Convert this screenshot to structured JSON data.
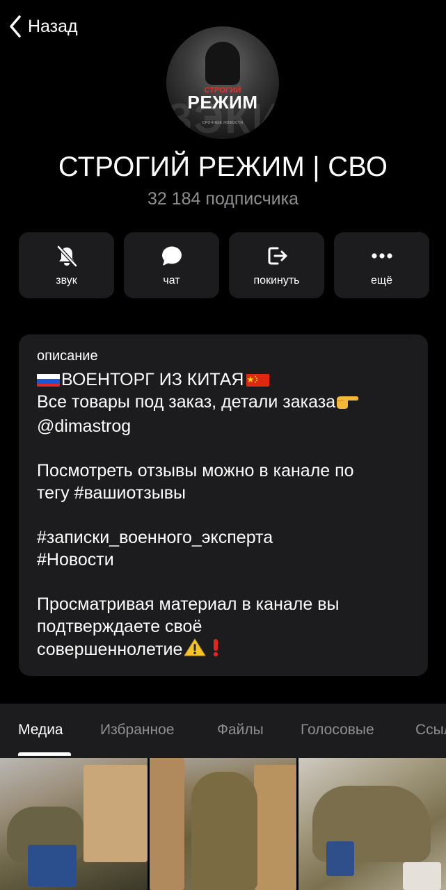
{
  "nav": {
    "back_label": "Назад"
  },
  "avatar": {
    "line1": "СТРОГИЙ",
    "line2": "РЕЖИМ",
    "line3": "СРОЧНЫЕ НОВОСТИ",
    "bg": "ЗЭКИ"
  },
  "channel": {
    "title": "СТРОГИЙ РЕЖИМ | СВО",
    "subscribers": "32 184 подписчика"
  },
  "actions": [
    {
      "label": "звук",
      "icon": "bell-slash-icon"
    },
    {
      "label": "чат",
      "icon": "chat-bubble-icon"
    },
    {
      "label": "покинуть",
      "icon": "leave-icon"
    },
    {
      "label": "ещё",
      "icon": "more-dots-icon"
    }
  ],
  "description": {
    "caption": "описание",
    "line1": "ВОЕНТОРГ ИЗ КИТАЯ",
    "line2": "Все товары под заказ, детали заказа",
    "line3": "@dimastrog",
    "line4": "Посмотреть отзывы можно в канале по",
    "line5": "тегу #вашиотзывы",
    "line6": "#записки_военного_эксперта",
    "line7": "#Новости",
    "line8": "Просматривая материал в канале вы",
    "line9": "подтверждаете своё",
    "line10": "совершеннолетие"
  },
  "tabs": [
    {
      "label": "Медиа",
      "active": true
    },
    {
      "label": "Избранное",
      "active": false
    },
    {
      "label": "Файлы",
      "active": false
    },
    {
      "label": "Голосовые",
      "active": false
    },
    {
      "label": "Ссылки",
      "active": false
    }
  ],
  "colors": {
    "background": "#000000",
    "card": "#1c1c1e",
    "secondary_text": "#8e8e93"
  }
}
